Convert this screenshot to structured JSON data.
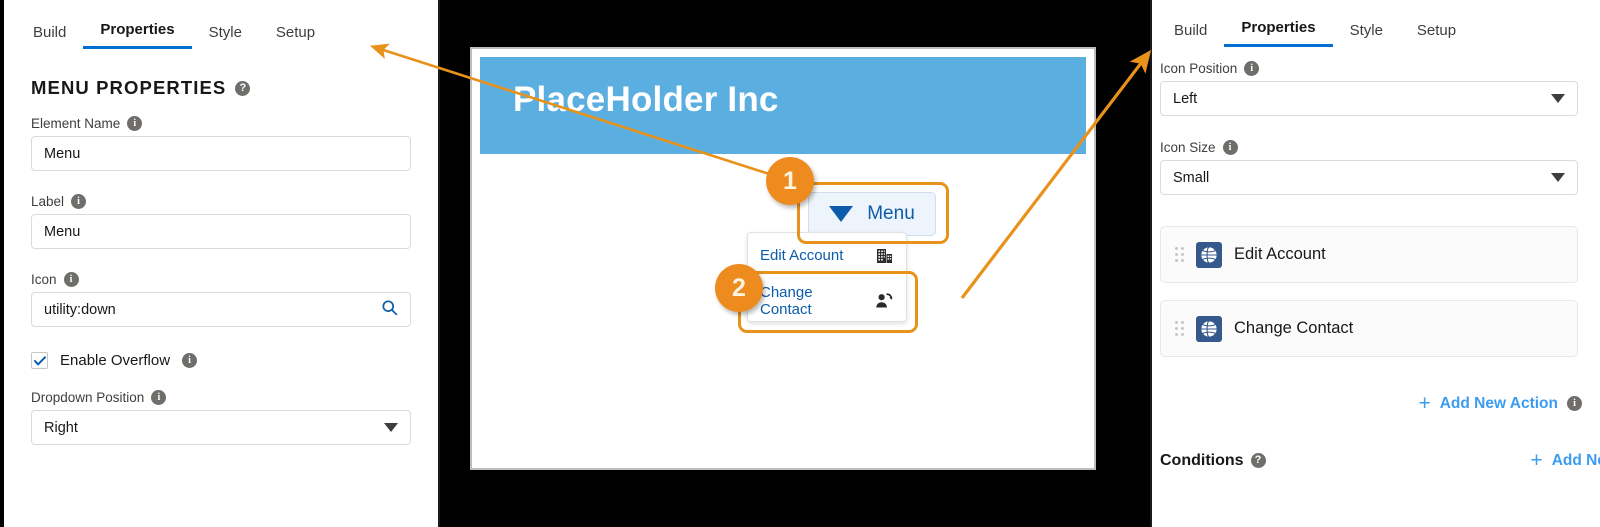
{
  "left_panel": {
    "tabs": [
      {
        "label": "Build",
        "active": false
      },
      {
        "label": "Properties",
        "active": true
      },
      {
        "label": "Style",
        "active": false
      },
      {
        "label": "Setup",
        "active": false
      }
    ],
    "section_title": "MENU PROPERTIES",
    "section_help_icon": "help-circle-icon",
    "fields": [
      {
        "label": "Element Name",
        "value": "Menu",
        "info_icon": "info-circle-icon",
        "type": "text"
      },
      {
        "label": "Label",
        "value": "Menu",
        "info_icon": "info-circle-icon",
        "type": "text"
      },
      {
        "label": "Icon",
        "value": "utility:down",
        "info_icon": "info-circle-icon",
        "type": "search",
        "trailing_icon": "search-icon"
      }
    ],
    "checkbox": {
      "label": "Enable Overflow",
      "checked": true,
      "info_icon": "info-circle-icon"
    },
    "dropdown_field": {
      "label": "Dropdown Position",
      "value": "Right",
      "info_icon": "info-circle-icon",
      "trailing_icon": "chevron-down-icon"
    }
  },
  "preview": {
    "brand_title": "PlaceHolder Inc",
    "brand_banner_color": "#5aaee0",
    "menu_button": {
      "label": "Menu",
      "icon": "caret-down-icon"
    },
    "dropdown_items": [
      {
        "label": "Edit Account",
        "icon": "building-icon"
      },
      {
        "label": "Change Contact",
        "icon": "user-switch-icon"
      }
    ]
  },
  "right_panel": {
    "tabs": [
      {
        "label": "Build",
        "active": false
      },
      {
        "label": "Properties",
        "active": true
      },
      {
        "label": "Style",
        "active": false
      },
      {
        "label": "Setup",
        "active": false
      }
    ],
    "fields": [
      {
        "label": "Icon Position",
        "value": "Left",
        "info_icon": "info-circle-icon",
        "trailing_icon": "chevron-down-icon"
      },
      {
        "label": "Icon Size",
        "value": "Small",
        "info_icon": "info-circle-icon",
        "trailing_icon": "chevron-down-icon"
      }
    ],
    "actions": [
      {
        "label": "Edit Account",
        "icon": "globe-icon",
        "drag_icon": "drag-handle-icon"
      },
      {
        "label": "Change Contact",
        "icon": "globe-icon",
        "drag_icon": "drag-handle-icon"
      }
    ],
    "add_action_link": {
      "label": "Add New Action",
      "plus": "+",
      "info_icon": "info-circle-icon"
    },
    "conditions": {
      "title": "Conditions",
      "help_icon": "help-circle-icon",
      "add_label": "Add New",
      "plus": "+"
    }
  },
  "callouts": [
    {
      "number": "1"
    },
    {
      "number": "2"
    }
  ],
  "colors": {
    "accent_blue": "#0070d2",
    "link_blue": "#3b9cf0",
    "callout_orange": "#ed8b1f",
    "highlight_orange": "#e8921b",
    "banner_blue": "#5aaee0"
  }
}
